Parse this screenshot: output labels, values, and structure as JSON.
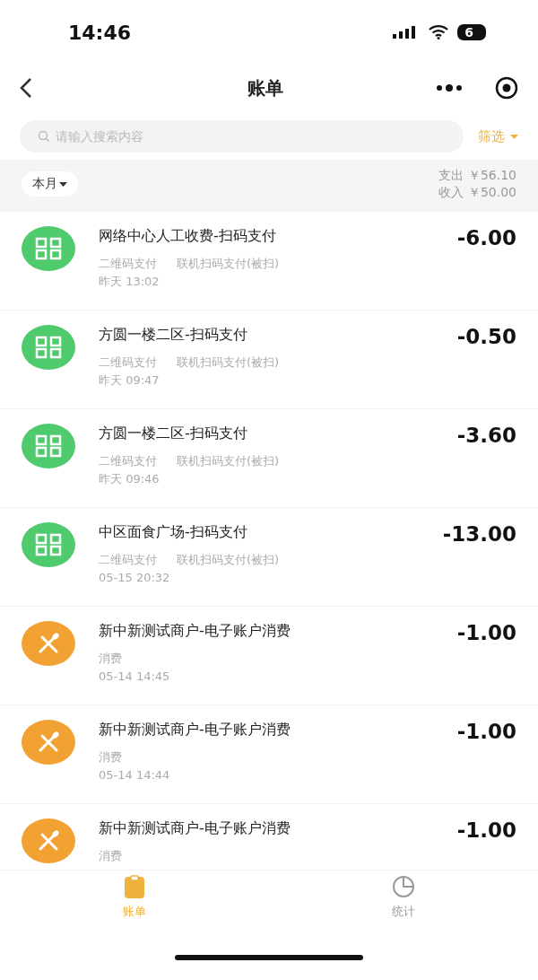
{
  "status_bar": {
    "time": "14:46",
    "battery": "6"
  },
  "nav": {
    "title": "账单"
  },
  "search": {
    "placeholder": "请输入搜索内容",
    "filter": "筛选"
  },
  "summary": {
    "period": "本月",
    "expense": "支出 ￥56.10",
    "income": "收入 ￥50.00"
  },
  "transactions": [
    {
      "kind": "qr",
      "title": "网络中心人工收费-扫码支付",
      "method": "二维码支付",
      "detail": "联机扫码支付(被扫)",
      "time": "昨天 13:02",
      "amount": "-6.00"
    },
    {
      "kind": "qr",
      "title": "方圆一楼二区-扫码支付",
      "method": "二维码支付",
      "detail": "联机扫码支付(被扫)",
      "time": "昨天 09:47",
      "amount": "-0.50"
    },
    {
      "kind": "qr",
      "title": "方圆一楼二区-扫码支付",
      "method": "二维码支付",
      "detail": "联机扫码支付(被扫)",
      "time": "昨天 09:46",
      "amount": "-3.60"
    },
    {
      "kind": "qr",
      "title": "中区面食广场-扫码支付",
      "method": "二维码支付",
      "detail": "联机扫码支付(被扫)",
      "time": "05-15 20:32",
      "amount": "-13.00"
    },
    {
      "kind": "dining",
      "title": "新中新测试商户-电子账户消费",
      "method": "消费",
      "time": "05-14 14:45",
      "amount": "-1.00"
    },
    {
      "kind": "dining",
      "title": "新中新测试商户-电子账户消费",
      "method": "消费",
      "time": "05-14 14:44",
      "amount": "-1.00"
    },
    {
      "kind": "dining",
      "title": "新中新测试商户-电子账户消费",
      "method": "消费",
      "amount": "-1.00"
    }
  ],
  "tab_bar": [
    {
      "label": "账单",
      "kind": "bill",
      "selected": true
    },
    {
      "label": "统计",
      "kind": "stats",
      "selected": false
    }
  ]
}
